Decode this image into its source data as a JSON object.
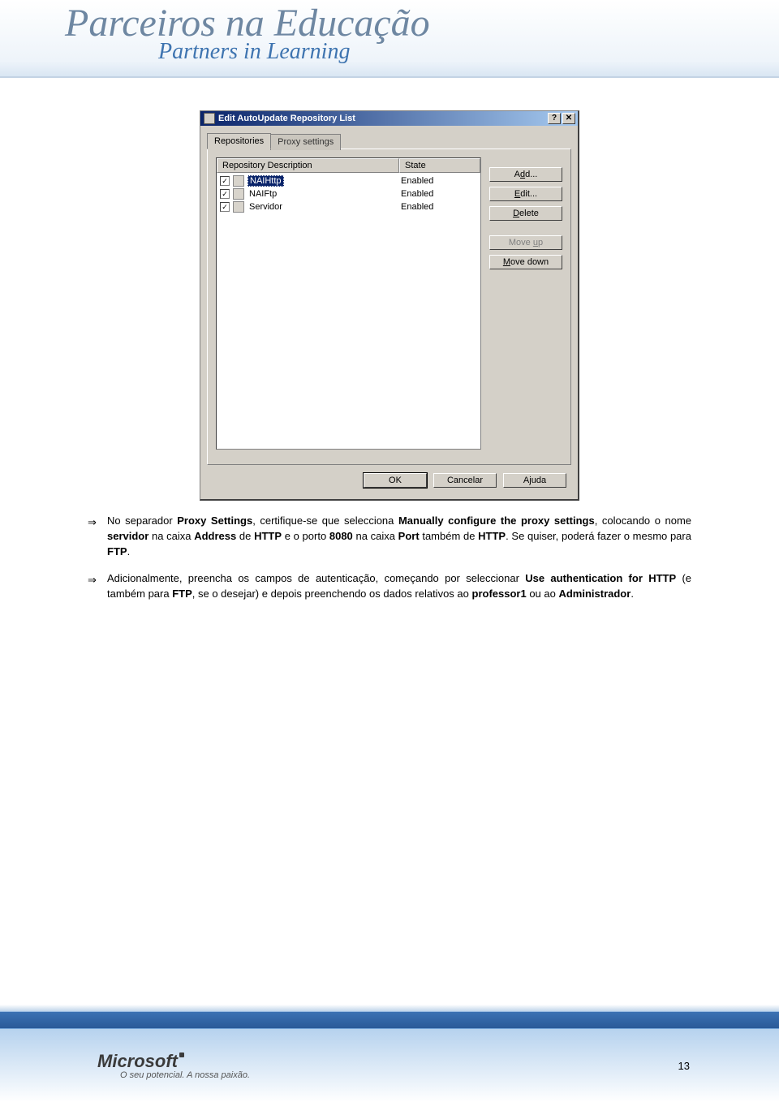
{
  "header": {
    "title": "Parceiros na Educação",
    "subtitle": "Partners in Learning"
  },
  "dialog": {
    "title": "Edit AutoUpdate Repository List",
    "tabs": {
      "repositories": "Repositories",
      "proxy": "Proxy settings"
    },
    "columns": {
      "desc": "Repository Description",
      "state": "State"
    },
    "rows": [
      {
        "name": "NAIHttp",
        "state": "Enabled"
      },
      {
        "name": "NAIFtp",
        "state": "Enabled"
      },
      {
        "name": "Servidor",
        "state": "Enabled"
      }
    ],
    "buttons": {
      "add_pre": "A",
      "add_ul": "d",
      "add_post": "d...",
      "edit_ul": "E",
      "edit_post": "dit...",
      "delete_ul": "D",
      "delete_post": "elete",
      "moveup_pre": "Move ",
      "moveup_ul": "u",
      "moveup_post": "p",
      "movedown_ul": "M",
      "movedown_post": "ove down",
      "ok": "OK",
      "cancel": "Cancelar",
      "help": "Ajuda"
    }
  },
  "body": {
    "p1_a": "No separador ",
    "p1_b1": "Proxy Settings",
    "p1_b": ", certifique-se que selecciona ",
    "p1_b2": "Manually configure the proxy settings",
    "p1_c": ", colocando o nome ",
    "p1_b3": "servidor",
    "p1_d": " na caixa ",
    "p1_b4": "Address",
    "p1_e": " de ",
    "p1_b5": "HTTP",
    "p1_f": " e o porto ",
    "p1_b6": "8080",
    "p1_g": " na caixa ",
    "p1_b7": "Port",
    "p1_h": " também de ",
    "p1_b8": "HTTP",
    "p1_i": ". Se quiser, poderá fazer o mesmo para ",
    "p1_b9": "FTP",
    "p1_j": ".",
    "p2_a": "Adicionalmente, preencha os campos de autenticação, começando por seleccionar ",
    "p2_b1": "Use authentication for HTTP",
    "p2_b": " (e também para ",
    "p2_b2": "FTP",
    "p2_c": ", se o desejar) e depois preenchendo os dados relativos ao ",
    "p2_b3": "professor1",
    "p2_d": " ou ao ",
    "p2_b4": "Administrador",
    "p2_e": "."
  },
  "footer": {
    "logo": "Microsoft",
    "tagline": "O seu potencial. A nossa paixão.",
    "pagenum": "13"
  },
  "glyphs": {
    "arrow": "⇒",
    "help": "?",
    "close": "✕",
    "check": "✓"
  }
}
